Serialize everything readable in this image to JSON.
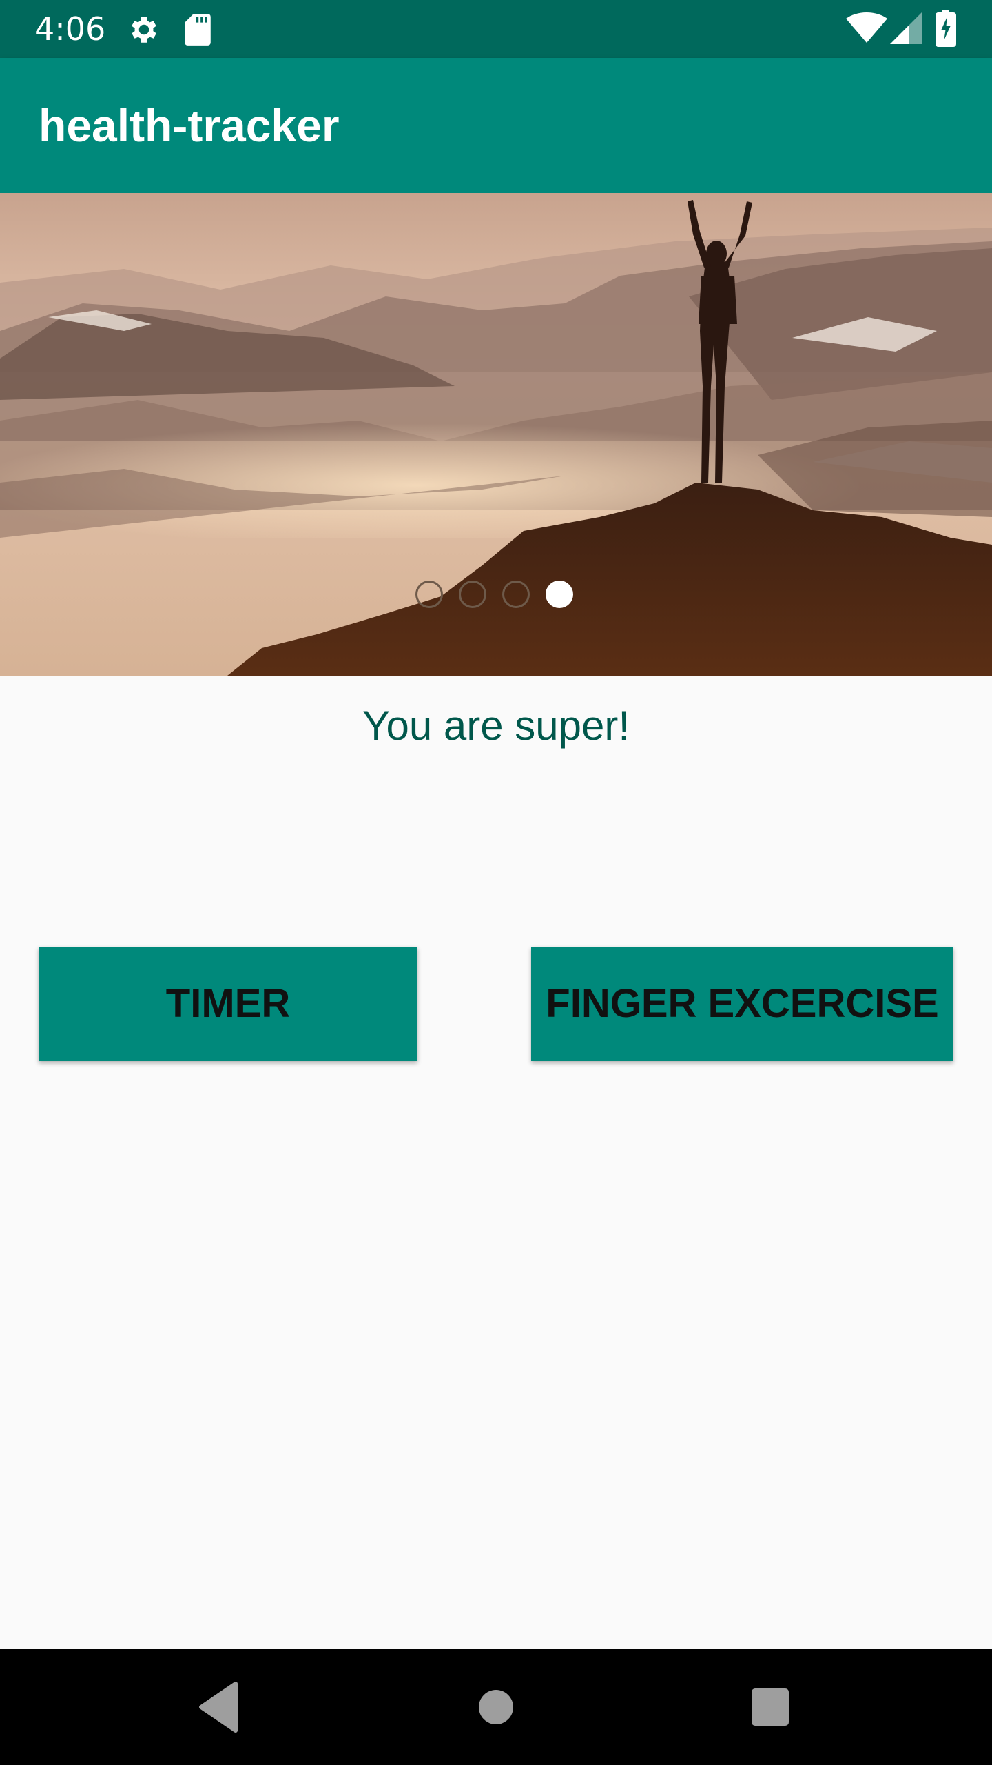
{
  "status_bar": {
    "time": "4:06",
    "left_icons": [
      "settings-gear-icon",
      "sd-card-icon"
    ],
    "right_icons": [
      "wifi-icon",
      "cellular-signal-icon",
      "battery-charging-icon"
    ]
  },
  "app_bar": {
    "title": "health-tracker",
    "color": "#00897b"
  },
  "carousel": {
    "image_description_icon": "mountain-summit-photo",
    "page_count": 4,
    "active_index": 3
  },
  "main": {
    "message": "You are super!",
    "buttons": {
      "timer": "TIMER",
      "finger_exercise": "FINGER EXCERCISE"
    }
  },
  "nav_bar": {
    "icons": [
      "back-icon",
      "home-icon",
      "recents-icon"
    ]
  },
  "colors": {
    "primary": "#00897b",
    "primary_dark": "#00695c",
    "accent_text": "#00574b",
    "background": "#fafafa"
  }
}
